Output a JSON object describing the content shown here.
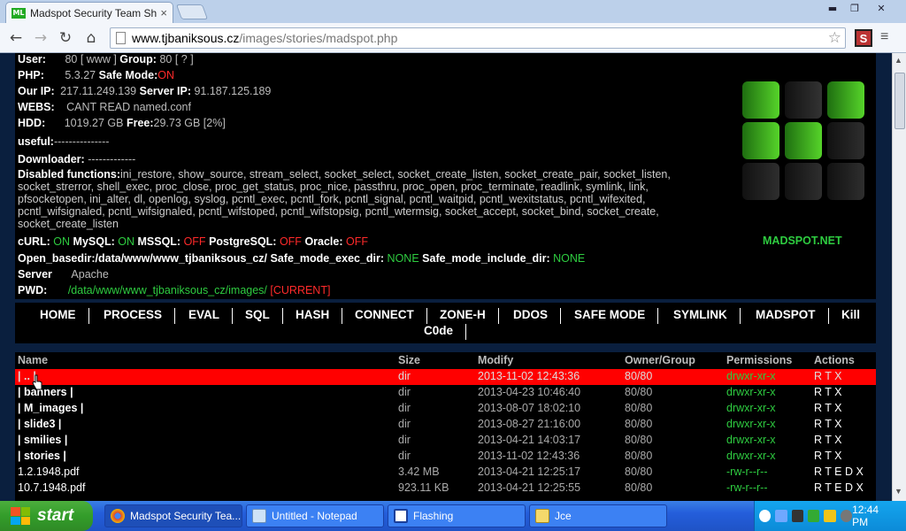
{
  "browser": {
    "tab_title": "Madspot Security Team Shell",
    "tab_close": "×",
    "favicon_text": "ML",
    "url_host": "www.tjbaniksous.cz",
    "url_path": "/images/stories/madspot.php",
    "star_icon": "☆",
    "extension_letter": "S"
  },
  "info": {
    "user_label": "User:",
    "user_value": "80 [ www ]",
    "group_label": "Group:",
    "group_value": "80 [ ? ]",
    "php_label": "PHP:",
    "php_value": "5.3.27",
    "safemode_label": "Safe Mode:",
    "safemode_value": "ON",
    "ourip_label": "Our IP:",
    "ourip_value": "217.11.249.139",
    "serverip_label": "Server IP:",
    "serverip_value": "91.187.125.189",
    "webs_label": "WEBS:",
    "webs_value": "CANT READ named.conf",
    "hdd_label": "HDD:",
    "hdd_value": "1019.27 GB",
    "free_label": "Free:",
    "free_value": "29.73 GB [2%]",
    "useful_label": "useful:",
    "useful_value": "---------------",
    "downloader_label": "Downloader:",
    "downloader_value": "-------------",
    "disabled_label": "Disabled functions:",
    "disabled_value": "ini_restore, show_source, stream_select, socket_select, socket_create_listen, socket_create_pair, socket_listen, socket_strerror, shell_exec, proc_close, proc_get_status, proc_nice, passthru, proc_open, proc_terminate, readlink, symlink, link, pfsocketopen, ini_alter, dl, openlog, syslog, pcntl_exec, pcntl_fork, pcntl_signal, pcntl_waitpid, pcntl_wexitstatus, pcntl_wifexited, pcntl_wifsignaled, pcntl_wifsignaled, pcntl_wifstoped, pcntl_wifstopsig, pcntl_wtermsig, socket_accept, socket_bind, socket_create, socket_create_listen",
    "curl_label": "cURL:",
    "curl_value": "ON",
    "mysql_label": "MySQL:",
    "mysql_value": "ON",
    "mssql_label": "MSSQL:",
    "mssql_value": "OFF",
    "postgre_label": "PostgreSQL:",
    "postgre_value": "OFF",
    "oracle_label": "Oracle:",
    "oracle_value": "OFF",
    "openbasedir_label": "Open_basedir:/data/www/www_tjbaniksous_cz/",
    "sm_exec_label": "Safe_mode_exec_dir:",
    "sm_exec_value": "NONE",
    "sm_include_label": "Safe_mode_include_dir:",
    "sm_include_value": "NONE",
    "server_label": "Server",
    "server_value": "Apache",
    "pwd_label": "PWD:",
    "pwd_value": "/data/www/www_tjbaniksous_cz/images/",
    "pwd_current": "[CURRENT]",
    "logo_text": "MADSPOT.NET"
  },
  "menu": [
    "HOME",
    "PROCESS",
    "EVAL",
    "SQL",
    "HASH",
    "CONNECT",
    "ZONE-H",
    "DDOS",
    "SAFE MODE",
    "SYMLINK",
    "MADSPOT",
    "Kill"
  ],
  "menu_second": "C0de",
  "files": {
    "headers": [
      "Name",
      "Size",
      "Modify",
      "Owner/Group",
      "Permissions",
      "Actions"
    ],
    "rows": [
      [
        "| .. |",
        "dir",
        "2013-11-02 12:43:36",
        "80/80",
        "drwxr-xr-x",
        "R T X"
      ],
      [
        "| banners |",
        "dir",
        "2013-04-23 10:46:40",
        "80/80",
        "drwxr-xr-x",
        "R T X"
      ],
      [
        "| M_images |",
        "dir",
        "2013-08-07 18:02:10",
        "80/80",
        "drwxr-xr-x",
        "R T X"
      ],
      [
        "| slide3 |",
        "dir",
        "2013-08-27 21:16:00",
        "80/80",
        "drwxr-xr-x",
        "R T X"
      ],
      [
        "| smilies |",
        "dir",
        "2013-04-21 14:03:17",
        "80/80",
        "drwxr-xr-x",
        "R T X"
      ],
      [
        "| stories |",
        "dir",
        "2013-11-02 12:43:36",
        "80/80",
        "drwxr-xr-x",
        "R T X"
      ],
      [
        "1.2.1948.pdf",
        "3.42 MB",
        "2013-04-21 12:25:17",
        "80/80",
        "-rw-r--r--",
        "R T E D X"
      ],
      [
        "10.7.1948.pdf",
        "923.11 KB",
        "2013-04-21 12:25:55",
        "80/80",
        "-rw-r--r--",
        "R T E D X"
      ]
    ]
  },
  "taskbar": {
    "start": "start",
    "tasks": [
      "Madspot Security Tea...",
      "Untitled - Notepad",
      "Flashing",
      "Jce"
    ],
    "clock": "12:44 PM"
  }
}
